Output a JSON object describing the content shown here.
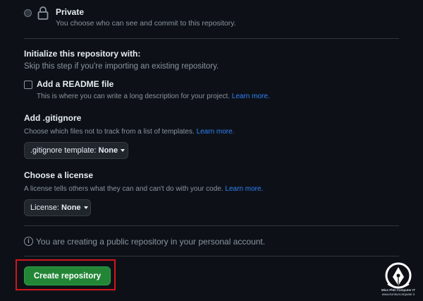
{
  "visibility": {
    "private_label": "Private",
    "private_description": "You choose who can see and commit to this repository."
  },
  "initialize": {
    "heading": "Initialize this repository with:",
    "subtext": "Skip this step if you're importing an existing repository."
  },
  "readme": {
    "label": "Add a README file",
    "description": "This is where you can write a long description for your project.",
    "learn_more": "Learn more."
  },
  "gitignore": {
    "heading": "Add .gitignore",
    "description": "Choose which files not to track from a list of templates.",
    "learn_more": "Learn more.",
    "select_prefix": ".gitignore template:",
    "select_value": "None"
  },
  "license": {
    "heading": "Choose a license",
    "description": "A license tells others what they can and can't do with your code.",
    "learn_more": "Learn more.",
    "select_prefix": "License:",
    "select_value": "None"
  },
  "notice": {
    "icon": "info-icon",
    "text": "You are creating a public repository in your personal account."
  },
  "actions": {
    "create_label": "Create repository"
  },
  "watermark": {
    "line1": "Miss PhD Computer IT",
    "line2": "www.konkurcomputer.ir"
  },
  "colors": {
    "background": "#0d1117",
    "link": "#2f81f7",
    "primary_button": "#238636",
    "highlight_box": "#d0151c"
  }
}
